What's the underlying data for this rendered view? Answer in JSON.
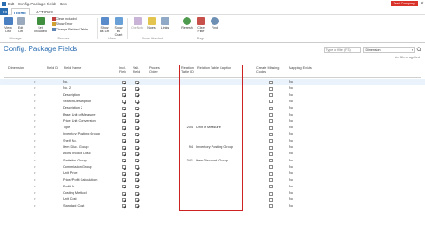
{
  "window": {
    "title": "Edit - Config. Package Fields - Item",
    "company_badge": "Test Company",
    "close_glyph": "✕"
  },
  "ribbon_tabs": {
    "file": "FILE",
    "home": "HOME",
    "actions": "ACTIONS"
  },
  "ribbon": {
    "view_list": "View List",
    "edit_list": "Edit List",
    "manage_label": "Manage",
    "set_included": "Set Included",
    "clear_included": "Clear Included",
    "show_error": "Show Error",
    "change_related_table": "Change Related Table",
    "process_label": "Process",
    "show_as_list": "Show as List",
    "show_as_chart": "Show as Chart",
    "view_label": "View",
    "onenote": "OneNote",
    "notes": "Notes",
    "links": "Links",
    "show_attached_label": "Show Attached",
    "refresh": "Refresh",
    "clear_filter": "Clear Filter",
    "find": "Find",
    "page_label": "Page"
  },
  "page": {
    "title": "Config. Package Fields",
    "filter_placeholder": "Type to filter (F3)",
    "filter_field": "Dimension",
    "no_filters": "No filters applied"
  },
  "columns": {
    "dimension": "Dimension",
    "field_id": "Field ID",
    "field_name": "Field Name",
    "include_field": "Incl. Field",
    "validate_field": "Vali. Field",
    "processing_order": "Proces. Order",
    "relation_table_id": "Relation Table ID",
    "relation_table_caption": "Relation Table Caption",
    "create_missing_codes": "Create Missing Codes",
    "mapping_exists": "Mapping Exists"
  },
  "rows": [
    {
      "field": "No.",
      "incl": true,
      "vali": true,
      "rel_id": "",
      "rel_caption": "",
      "mapping": "No"
    },
    {
      "field": "No. 2",
      "incl": true,
      "vali": true,
      "rel_id": "",
      "rel_caption": "",
      "mapping": "No"
    },
    {
      "field": "Description",
      "incl": true,
      "vali": true,
      "rel_id": "",
      "rel_caption": "",
      "mapping": "No"
    },
    {
      "field": "Search Description",
      "incl": true,
      "vali": true,
      "rel_id": "",
      "rel_caption": "",
      "mapping": "No"
    },
    {
      "field": "Description 2",
      "incl": true,
      "vali": true,
      "rel_id": "",
      "rel_caption": "",
      "mapping": "No"
    },
    {
      "field": "Base Unit of Measure",
      "incl": true,
      "vali": true,
      "rel_id": "",
      "rel_caption": "",
      "mapping": "No"
    },
    {
      "field": "Price Unit Conversion",
      "incl": true,
      "vali": true,
      "rel_id": "",
      "rel_caption": "",
      "mapping": "No"
    },
    {
      "field": "Type",
      "incl": true,
      "vali": true,
      "rel_id": "204",
      "rel_caption": "Unit of Measure",
      "mapping": "No"
    },
    {
      "field": "Inventory Posting Group",
      "incl": true,
      "vali": true,
      "rel_id": "",
      "rel_caption": "",
      "mapping": "No"
    },
    {
      "field": "Shelf No.",
      "incl": true,
      "vali": true,
      "rel_id": "",
      "rel_caption": "",
      "mapping": "No"
    },
    {
      "field": "Item Disc. Group",
      "incl": true,
      "vali": true,
      "rel_id": "94",
      "rel_caption": "Inventory Posting Group",
      "mapping": "No"
    },
    {
      "field": "Allow Invoice Disc.",
      "incl": true,
      "vali": true,
      "rel_id": "",
      "rel_caption": "",
      "mapping": "No"
    },
    {
      "field": "Statistics Group",
      "incl": true,
      "vali": true,
      "rel_id": "341",
      "rel_caption": "Item Discount Group",
      "mapping": "No"
    },
    {
      "field": "Commission Group",
      "incl": true,
      "vali": true,
      "rel_id": "",
      "rel_caption": "",
      "mapping": "No"
    },
    {
      "field": "Unit Price",
      "incl": true,
      "vali": true,
      "rel_id": "",
      "rel_caption": "",
      "mapping": "No"
    },
    {
      "field": "Price/Profit Calculation",
      "incl": true,
      "vali": true,
      "rel_id": "",
      "rel_caption": "",
      "mapping": "No"
    },
    {
      "field": "Profit %",
      "incl": true,
      "vali": true,
      "rel_id": "",
      "rel_caption": "",
      "mapping": "No"
    },
    {
      "field": "Costing Method",
      "incl": true,
      "vali": true,
      "rel_id": "",
      "rel_caption": "",
      "mapping": "No"
    },
    {
      "field": "Unit Cost",
      "incl": true,
      "vali": true,
      "rel_id": "",
      "rel_caption": "",
      "mapping": "No"
    },
    {
      "field": "Standard Cost",
      "incl": true,
      "vali": true,
      "rel_id": "",
      "rel_caption": "",
      "mapping": "No"
    }
  ],
  "colors": {
    "accent": "#2a6db0",
    "badge": "#d9322b",
    "highlight_box": "#cc2222"
  }
}
